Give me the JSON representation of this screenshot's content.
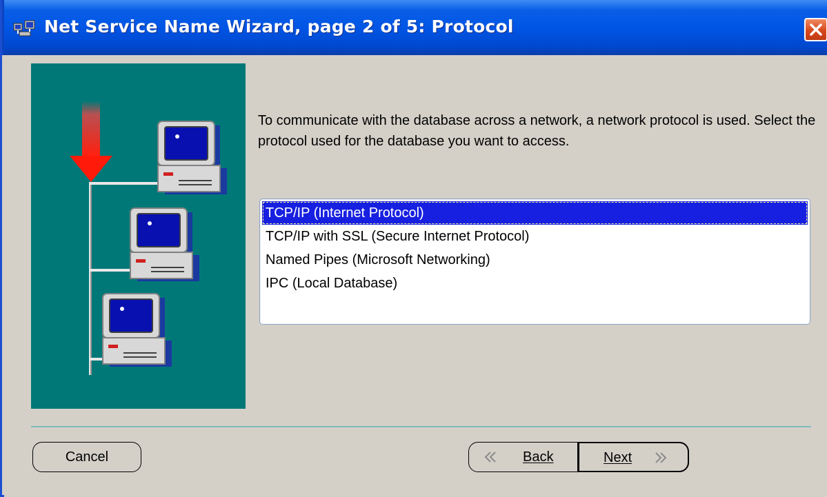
{
  "window": {
    "title": "Net Service Name Wizard, page 2 of 5: Protocol",
    "icon": "wizard-app-icon",
    "close_icon": "close-icon"
  },
  "description": "To communicate with the database across a network, a network protocol is used.  Select the protocol used for the database you want to access.",
  "protocol_list": {
    "items": [
      {
        "label": "TCP/IP (Internet Protocol)",
        "selected": true
      },
      {
        "label": "TCP/IP with SSL (Secure Internet Protocol)",
        "selected": false
      },
      {
        "label": "Named Pipes (Microsoft Networking)",
        "selected": false
      },
      {
        "label": "IPC (Local Database)",
        "selected": false
      }
    ]
  },
  "buttons": {
    "cancel": "Cancel",
    "back": "Back",
    "next": "Next"
  },
  "colors": {
    "title_bar": "#0055e5",
    "illustration_bg": "#007878",
    "selection": "#1720e0",
    "arrow": "#e82010"
  }
}
